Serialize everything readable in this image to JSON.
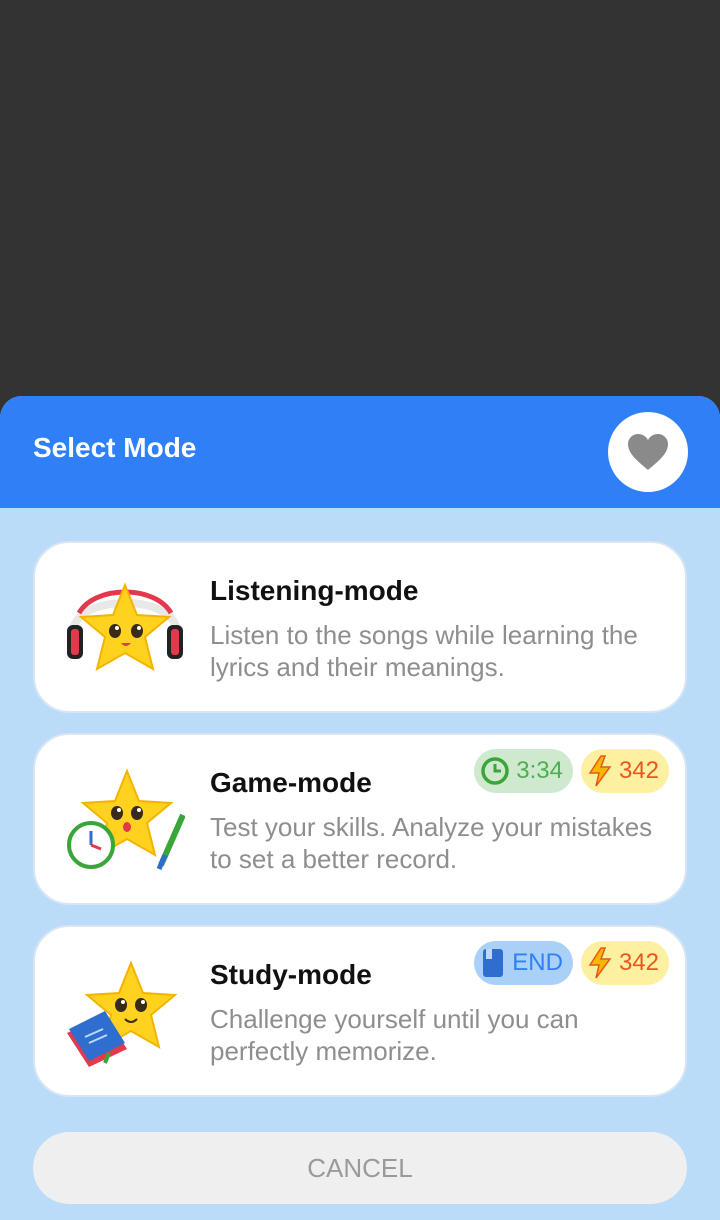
{
  "dialog": {
    "title": "Select Mode",
    "favorite_icon": "heart-icon"
  },
  "modes": [
    {
      "title": "Listening-mode",
      "description": "Listen to the songs while learning the lyrics and their meanings.",
      "illustration": "star-headphones-illustration"
    },
    {
      "title": "Game-mode",
      "description": "Test your skills. Analyze your mistakes to set a better record.",
      "illustration": "star-clock-pen-illustration",
      "badges": [
        {
          "icon": "clock-icon",
          "value": "3:34"
        },
        {
          "icon": "lightning-icon",
          "value": "342"
        }
      ]
    },
    {
      "title": "Study-mode",
      "description": "Challenge yourself until you can perfectly memorize.",
      "illustration": "star-book-illustration",
      "badges": [
        {
          "icon": "book-icon",
          "value": "END"
        },
        {
          "icon": "lightning-icon",
          "value": "342"
        }
      ]
    }
  ],
  "cancel_label": "CANCEL",
  "colors": {
    "header": "#2f80f7",
    "sheet_background": "#bbdcf8",
    "time_badge": "#cfe9cf",
    "points_badge": "#fdf0a0",
    "status_badge": "#a9d0f7"
  }
}
